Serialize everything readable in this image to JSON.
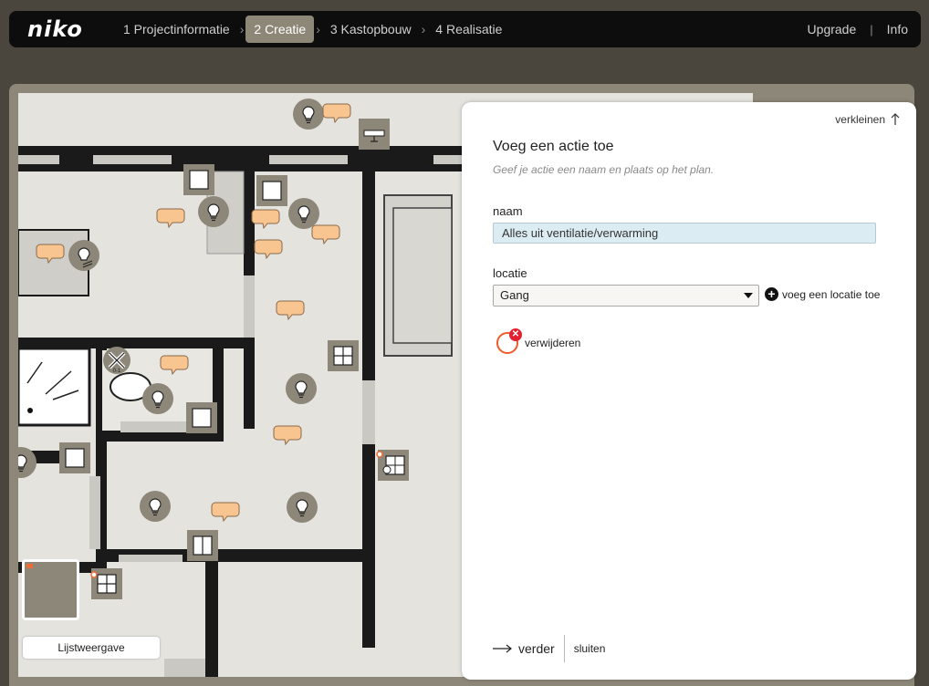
{
  "brand": "niko",
  "steps": [
    {
      "label": "1 Projectinformatie",
      "active": false
    },
    {
      "label": "2 Creatie",
      "active": true
    },
    {
      "label": "3 Kastopbouw",
      "active": false
    },
    {
      "label": "4 Realisatie",
      "active": false
    }
  ],
  "toplinks": {
    "upgrade": "Upgrade",
    "info": "Info"
  },
  "panel": {
    "shrink_label": "verkleinen",
    "title": "Voeg een actie toe",
    "subtitle": "Geef je actie een naam en plaats op het plan.",
    "name_label": "naam",
    "name_value": "Alles uit ventilatie/verwarming",
    "location_label": "locatie",
    "location_value": "Gang",
    "add_location_label": "voeg een locatie toe",
    "remove_label": "verwijderen",
    "next_label": "verder",
    "close_label": "sluiten"
  },
  "listview_label": "Lijstweergave",
  "colors": {
    "accent_active": "#8d8777",
    "bubble": "#f8c591",
    "danger": "#e22030",
    "input_bg": "#dcecf3"
  }
}
